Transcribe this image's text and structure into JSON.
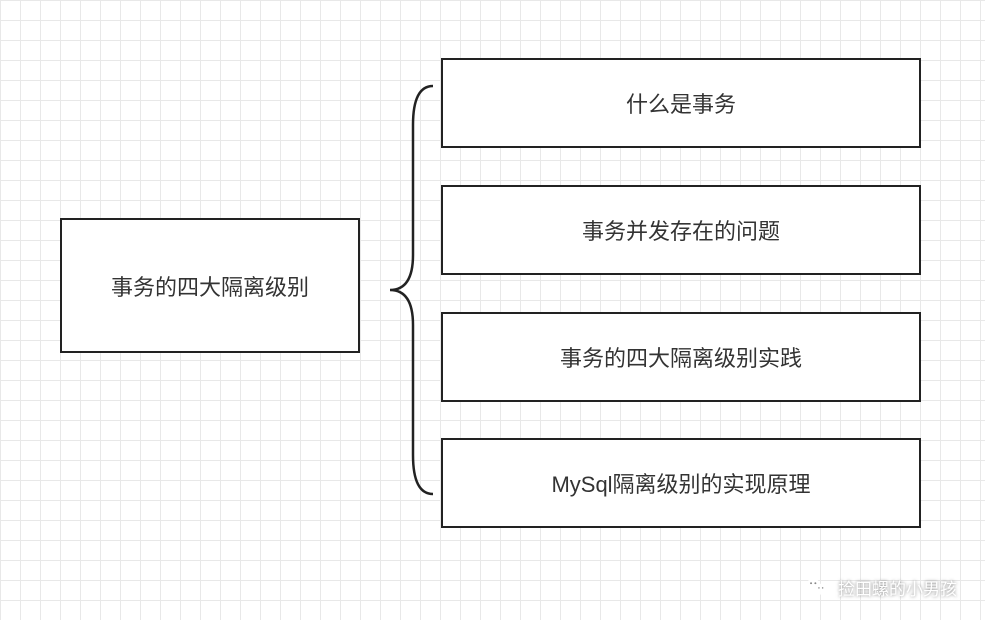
{
  "diagram": {
    "root": "事务的四大隔离级别",
    "children": [
      "什么是事务",
      "事务并发存在的问题",
      "事务的四大隔离级别实践",
      "MySql隔离级别的实现原理"
    ]
  },
  "watermark": {
    "text": "捡田螺的小男孩"
  }
}
